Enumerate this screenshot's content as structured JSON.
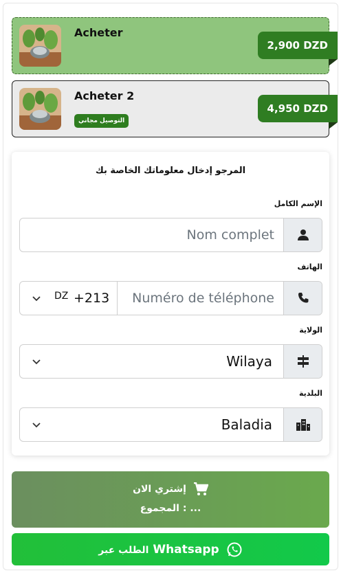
{
  "offers": [
    {
      "title": "Acheter",
      "price": "2,900 DZD",
      "badge": ""
    },
    {
      "title": "Acheter 2",
      "price": "4,950 DZD",
      "badge": "التوصيل مجاني"
    }
  ],
  "form": {
    "header": "المرجو إدخال معلوماتك الخاصة بك",
    "name_label": "الإسم الكامل",
    "name_placeholder": "Nom complet",
    "phone_label": "الهاتف",
    "country_code": "DZ",
    "dial_code": "+213",
    "phone_placeholder": "Numéro de téléphone",
    "wilaya_label": "الولاية",
    "wilaya_value": "Wilaya",
    "baladia_label": "البلدية",
    "baladia_value": "Baladia"
  },
  "buy_button": {
    "label": "إشتري الان",
    "total": "المجموع : ..."
  },
  "whatsapp_button": {
    "label_ar": "الطلب عبر",
    "label_brand": "Whatsapp"
  },
  "colors": {
    "selected_offer": "#8fc57d",
    "price_tag": "#2f7d22",
    "buy": "#6aa94d",
    "whatsapp": "#22bf39"
  },
  "icons": [
    "user-icon",
    "phone-icon",
    "signpost-icon",
    "city-icon",
    "cart-icon",
    "whatsapp-icon",
    "chevron-down-icon"
  ]
}
